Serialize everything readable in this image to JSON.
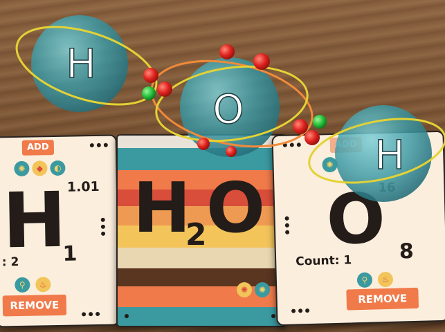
{
  "card_hydrogen": {
    "add_label": "ADD",
    "symbol": "H",
    "atomic_mass": "1.01",
    "atomic_number": "1",
    "count_text": ": 2",
    "remove_label": "REMOVE"
  },
  "card_molecule": {
    "formula_main": "H",
    "formula_sub": "2",
    "formula_end": "O",
    "stripe_colors": [
      "#3a9aa0",
      "#f07a4a",
      "#d94e3a",
      "#ef9a52",
      "#f2c45a",
      "#e8d7b0",
      "#5a3520",
      "#f07a4a"
    ]
  },
  "card_oxygen": {
    "add_label": "ADD",
    "symbol": "O",
    "atomic_mass": "16",
    "atomic_number": "8",
    "count_text": "Count: 1",
    "remove_label": "REMOVE"
  },
  "atoms": {
    "left_label": "H",
    "center_label": "O",
    "right_label": "H"
  },
  "colors": {
    "atom_fill": "#3aa0ac",
    "orbit_yellow": "#e3d235",
    "orbit_orange": "#f08a3a",
    "electron_red": "#e0231e",
    "electron_green": "#25c23a",
    "button": "#f07a4a"
  },
  "icons": [
    "cell-icon",
    "gem-icon",
    "coin-icon",
    "satellite-icon",
    "flame-icon",
    "cell-icon"
  ]
}
